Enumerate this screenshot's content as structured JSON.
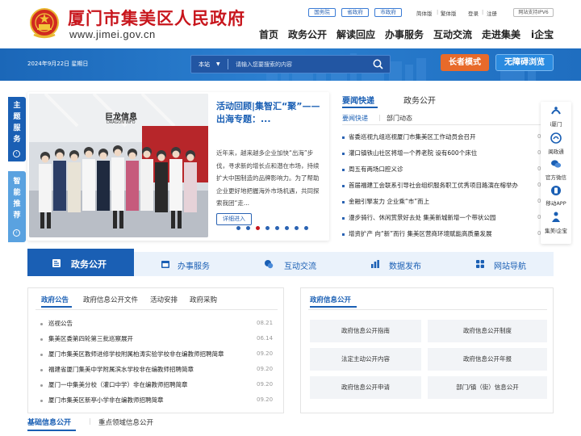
{
  "header": {
    "title": "厦门市集美区人民政府",
    "url": "www.jimei.gov.cn",
    "gov_links": [
      "国务院",
      "省政府",
      "市政府"
    ],
    "top_links": [
      "简体版",
      "繁体版",
      "登录",
      "注册"
    ],
    "ipv6": "网站支持IPV6",
    "nav": [
      "首页",
      "政务公开",
      "解读回应",
      "办事服务",
      "互动交流",
      "走进集美",
      "i企宝"
    ]
  },
  "banner": {
    "date": "2024年9月22日 星期日",
    "search_scope": "本站",
    "search_placeholder": "请输入您要搜索的内容",
    "elder_mode": "长者模式",
    "accessible": "无障碍浏览"
  },
  "side_tabs": {
    "topic": "主题服务",
    "smart": "智能推荐"
  },
  "feature": {
    "title": "活动回顾|集智汇“聚”—— 出海专题：...",
    "summary": "近年来，越来越多企业加快“出海”步伐，寻求新的增长点和潜在市场，持续扩大中国制造的品牌影响力。为了帮助企业更好地把握海外市场机遇，共同探索我团“走...",
    "detail": "详细进入",
    "sign_text": "巨龙信息",
    "sign_text_en": "DRAGON INFO",
    "slide_count": 8,
    "active_slide": 3
  },
  "news": {
    "tabs": [
      "要闻快递",
      "政务公开"
    ],
    "sub_tabs": [
      "要闻快递",
      "部门动态"
    ],
    "items": [
      {
        "title": "省委巡视九组巡视厦门市集美区工作动员会召开",
        "date": "0"
      },
      {
        "title": "灌口镇铁山社区将增一个养老院 设有600个床位",
        "date": "0"
      },
      {
        "title": "周五有两场口腔义诊",
        "date": "0"
      },
      {
        "title": "首届福建工会联系引导社会组织服务职工优秀项目路演在榕举办",
        "date": "0"
      },
      {
        "title": "金融引擎发力 企业乘“市”而上",
        "date": "0"
      },
      {
        "title": "漫步骑行、休闲赏景好去处 集美新城新增一个带状公园",
        "date": "0"
      },
      {
        "title": "增资扩产 向“新”而行 集美区营商环境赋能高质量发展",
        "date": "0"
      }
    ]
  },
  "right_rail": [
    "i厦门",
    "闽政通",
    "官方微信",
    "移动APP",
    "集美i企宝"
  ],
  "section_tabs": [
    "政务公开",
    "办事服务",
    "互动交流",
    "数据发布",
    "网站导航"
  ],
  "gov_notice": {
    "tabs": [
      "政府公告",
      "政府信息公开文件",
      "活动安排",
      "政府采购"
    ],
    "items": [
      {
        "title": "巡视公告",
        "date": "08.21"
      },
      {
        "title": "集美区委第四轮第三批巡察展开",
        "date": "06.14"
      },
      {
        "title": "厦门市集美区教师进修学校附属柏涛实验学校非在编教师招聘简章",
        "date": "09.20"
      },
      {
        "title": "福建省厦门集美中学附属滨水学校非在编教师招聘简章",
        "date": "09.20"
      },
      {
        "title": "厦门一中集美分校（灌口中学）非在编教师招聘简章",
        "date": "09.20"
      },
      {
        "title": "厦门市集美区新亭小学非在编教师招聘简章",
        "date": "09.20"
      }
    ]
  },
  "gov_info": {
    "title": "政府信息公开",
    "buttons": [
      "政府信息公开指南",
      "政府信息公开制度",
      "法定主动公开内容",
      "政府信息公开年报",
      "政府信息公开申请",
      "部门/镇（街）信息公开"
    ]
  },
  "bottom_tabs": [
    "基础信息公开",
    "重点领域信息公开"
  ],
  "colors": {
    "brand_red": "#c8161d",
    "primary_blue": "#1a5fb4",
    "elder_orange": "#e86a2a"
  }
}
